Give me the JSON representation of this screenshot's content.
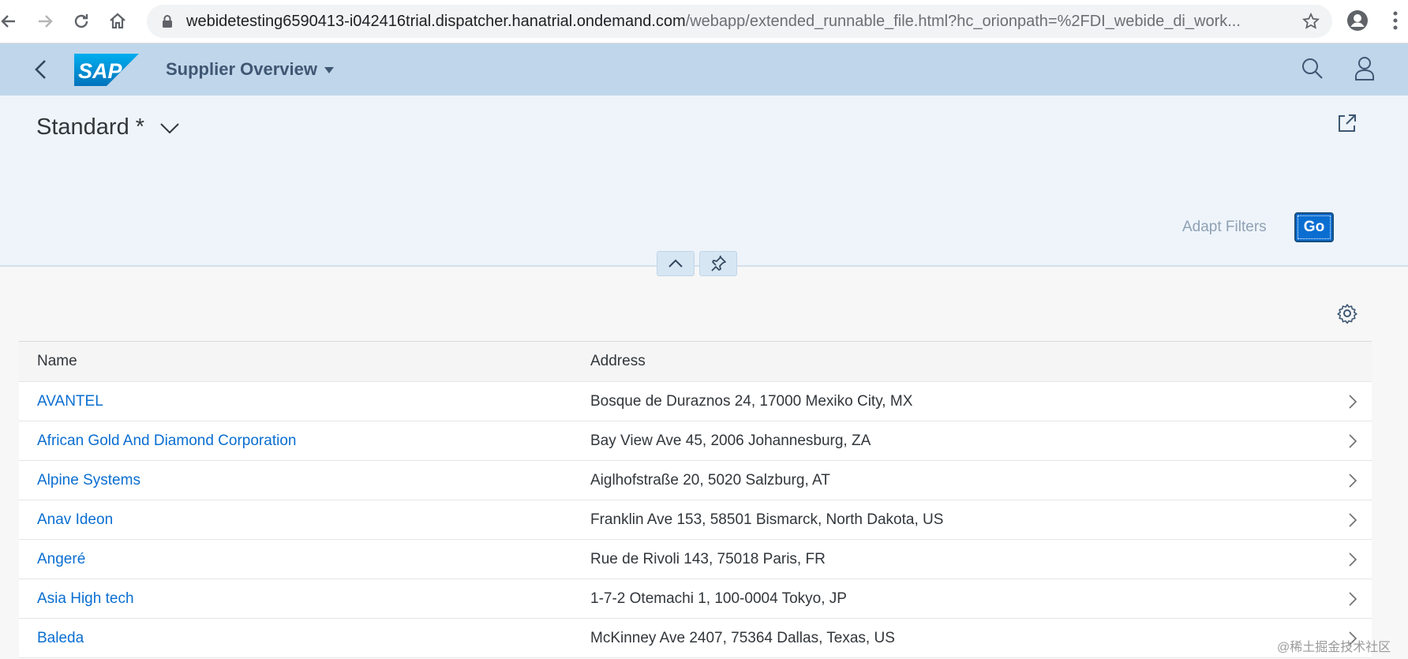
{
  "browser": {
    "url_host": "webidetesting6590413-i042416trial.dispatcher.hanatrial.ondemand.com",
    "url_path": "/webapp/extended_runnable_file.html?hc_orionpath=%2FDI_webide_di_work..."
  },
  "shell": {
    "title": "Supplier Overview"
  },
  "page_header": {
    "variant": "Standard *",
    "adapt_filters": "Adapt Filters",
    "go": "Go"
  },
  "table": {
    "columns": [
      "Name",
      "Address"
    ],
    "rows": [
      {
        "name": "AVANTEL",
        "address": "Bosque de Duraznos 24, 17000 Mexiko City, MX"
      },
      {
        "name": "African Gold And Diamond Corporation",
        "address": "Bay View Ave 45, 2006 Johannesburg, ZA"
      },
      {
        "name": "Alpine Systems",
        "address": "Aiglhofstraße 20, 5020 Salzburg, AT"
      },
      {
        "name": "Anav Ideon",
        "address": "Franklin Ave 153, 58501 Bismarck, North Dakota, US"
      },
      {
        "name": "Angeré",
        "address": "Rue de Rivoli 143, 75018 Paris, FR"
      },
      {
        "name": "Asia High tech",
        "address": "1-7-2 Otemachi 1, 100-0004 Tokyo, JP"
      },
      {
        "name": "Baleda",
        "address": "McKinney Ave 2407, 75364 Dallas, Texas, US"
      }
    ]
  },
  "watermark": "@稀土掘金技术社区",
  "colors": {
    "shell_bg": "#c0d6ea",
    "header_bg": "#eef4fa",
    "link": "#0a6ed1",
    "go_button": "#0a6ed1"
  }
}
